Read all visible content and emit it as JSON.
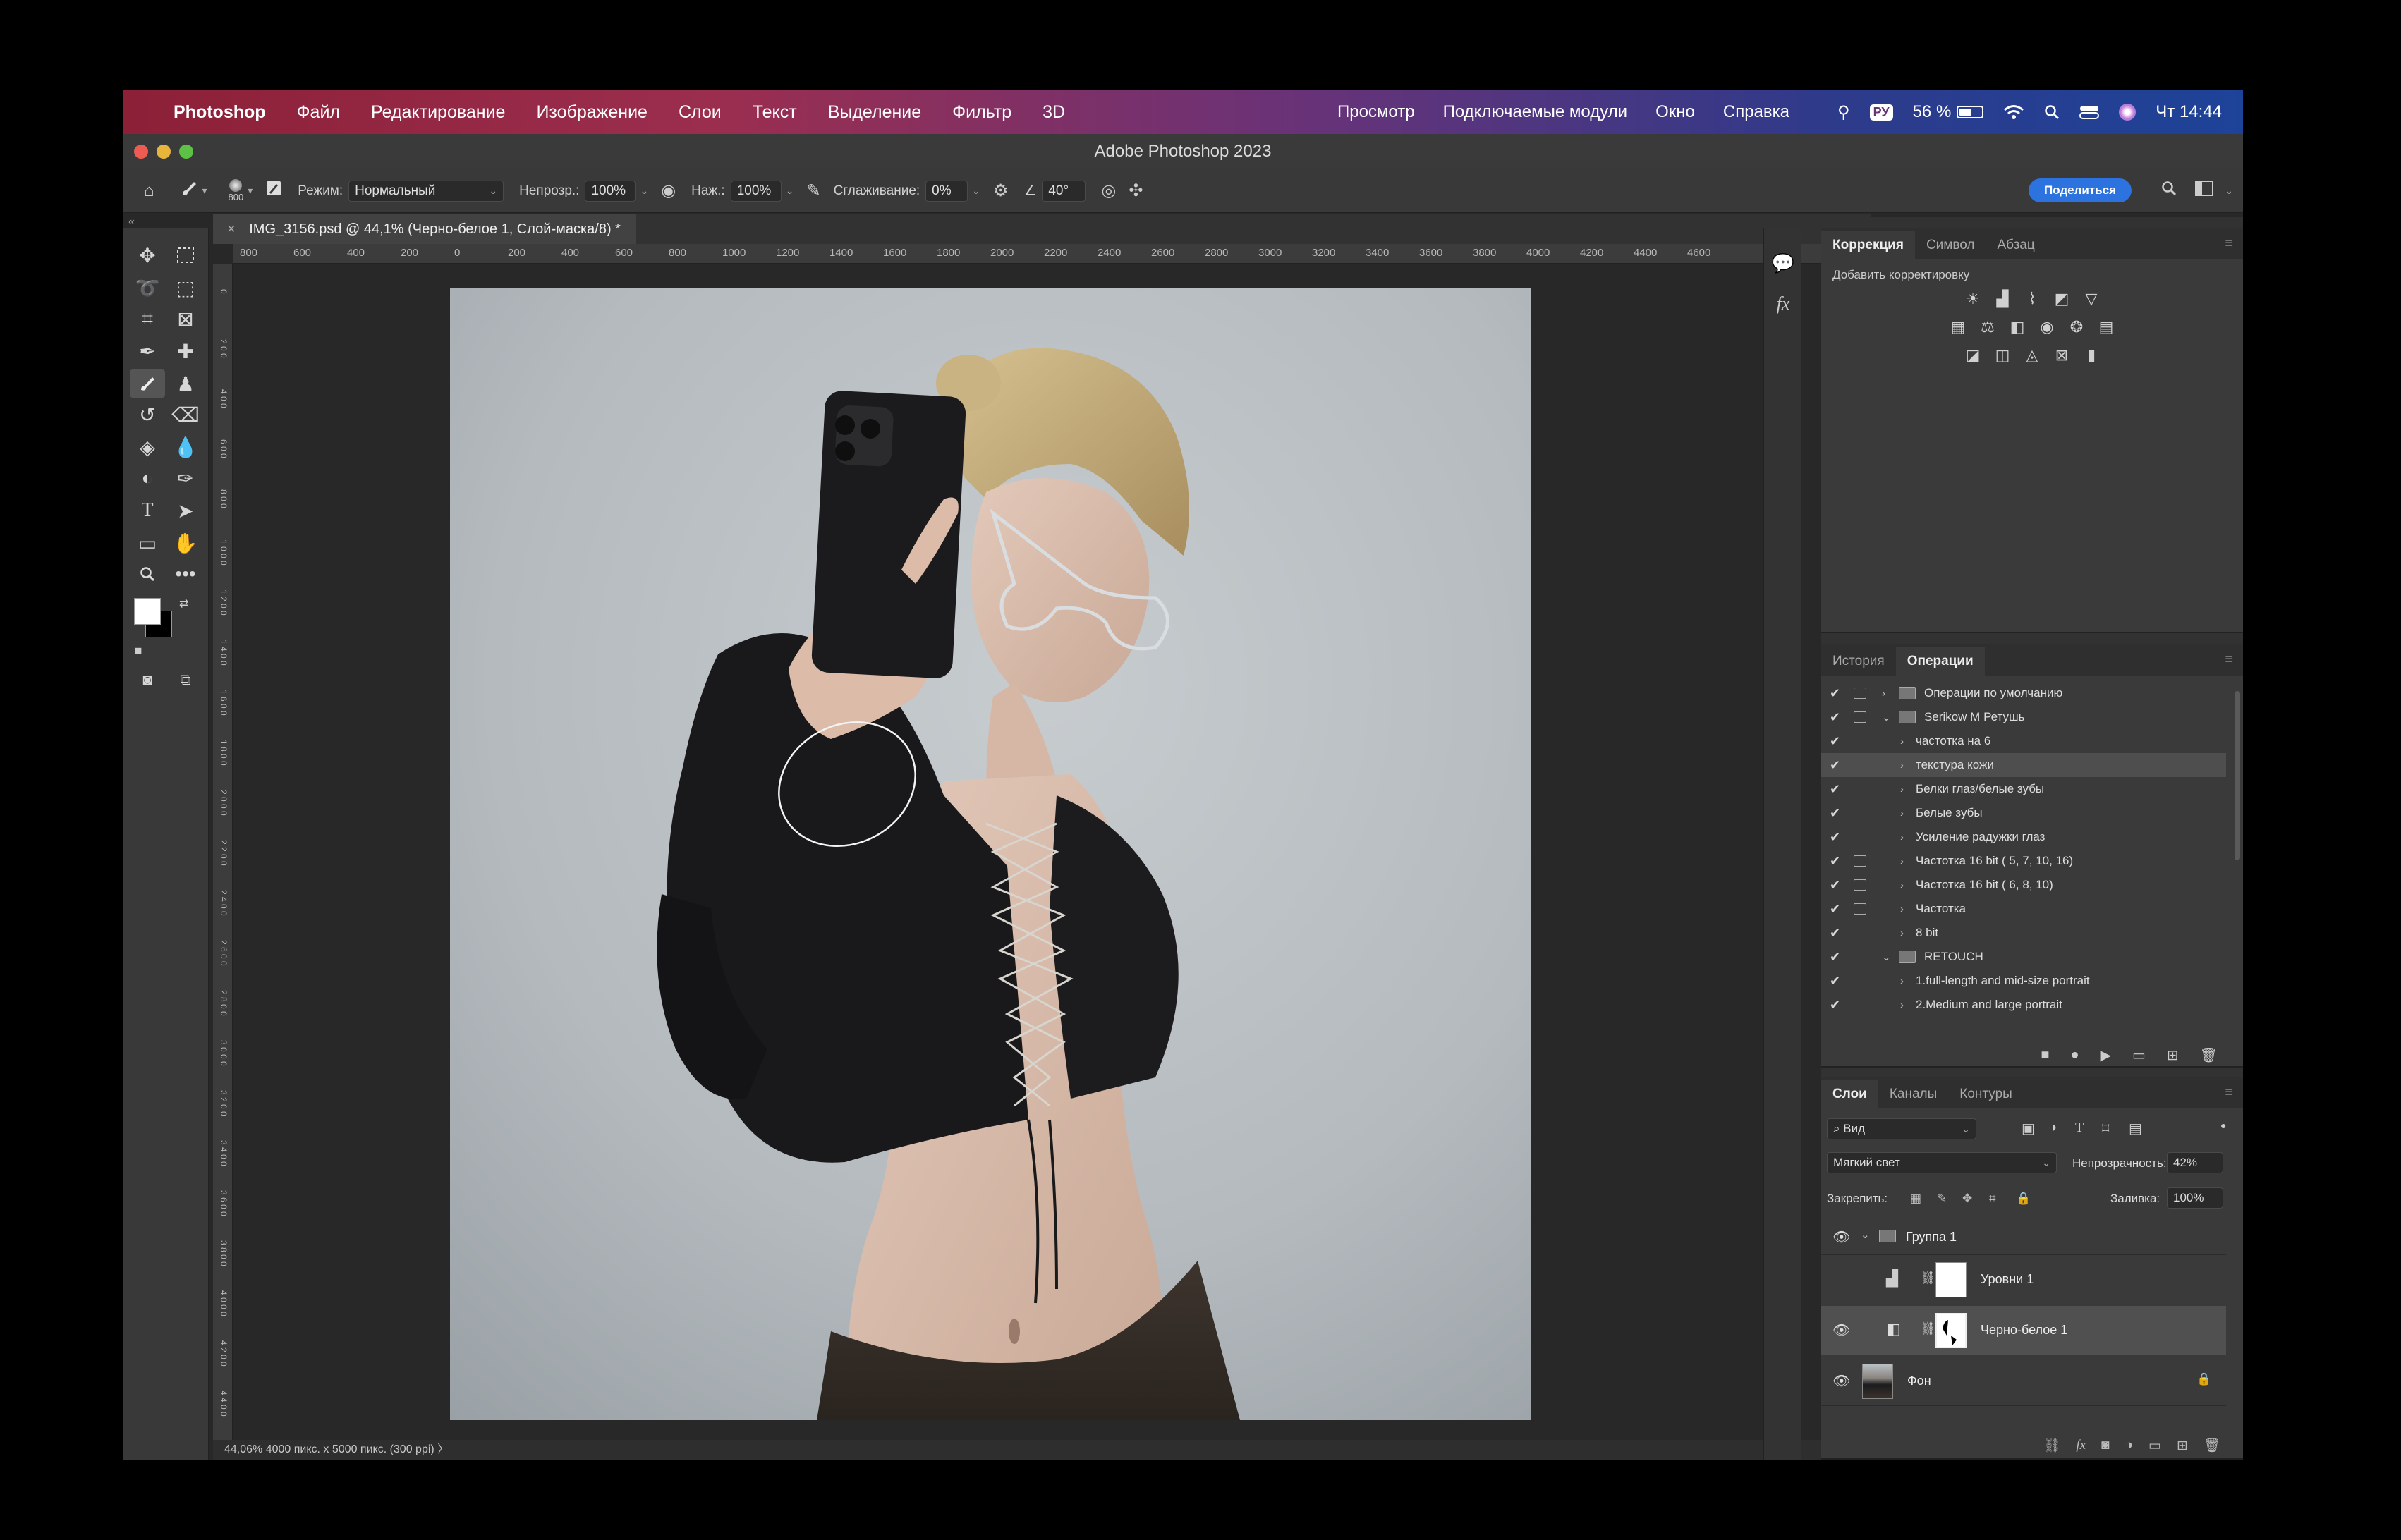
{
  "menubar": {
    "app_name": "Photoshop",
    "items": [
      "Файл",
      "Редактирование",
      "Изображение",
      "Слои",
      "Текст",
      "Выделение",
      "Фильтр",
      "3D"
    ],
    "right_items": [
      "Просмотр",
      "Подключаемые модули",
      "Окно",
      "Справка"
    ],
    "status": {
      "keyboard_layout": "РУ",
      "battery": "56 %",
      "battery_level": 0.56,
      "clock": "Чт 14:44"
    }
  },
  "window": {
    "title": "Adobe Photoshop 2023"
  },
  "options": {
    "brush_size": "800",
    "mode_label": "Режим:",
    "mode_value": "Нормальный",
    "opacity_label": "Непрозр.:",
    "opacity_value": "100%",
    "pressure_label": "Наж.:",
    "pressure_value": "100%",
    "smoothing_label": "Сглаживание:",
    "smoothing_value": "0%",
    "angle_value": "40°",
    "share_label": "Поделиться"
  },
  "document": {
    "tab_title": "IMG_3156.psd @ 44,1% (Черно-белое 1, Слой-маска/8) *",
    "status": "44,06%    4000 пикс. x 5000 пикс. (300 ppi)  〉",
    "ruler_h": [
      "800",
      "600",
      "400",
      "200",
      "0",
      "200",
      "400",
      "600",
      "800",
      "1000",
      "1200",
      "1400",
      "1600",
      "1800",
      "2000",
      "2200",
      "2400",
      "2600",
      "2800",
      "3000",
      "3200",
      "3400",
      "3600",
      "3800",
      "4000",
      "4200",
      "4400",
      "4600"
    ],
    "ruler_v": [
      "0",
      "2 0 0",
      "4 0 0",
      "6 0 0",
      "8 0 0",
      "1 0 0 0",
      "1 2 0 0",
      "1 4 0 0",
      "1 6 0 0",
      "1 8 0 0",
      "2 0 0 0",
      "2 2 0 0",
      "2 4 0 0",
      "2 6 0 0",
      "2 8 0 0",
      "3 0 0 0",
      "3 2 0 0",
      "3 4 0 0",
      "3 6 0 0",
      "3 8 0 0",
      "4 0 0 0",
      "4 2 0 0",
      "4 4 0 0",
      "4 6 0 0",
      "4 8 0 0"
    ]
  },
  "adjustments_panel": {
    "tabs": [
      "Коррекция",
      "Символ",
      "Абзац"
    ],
    "subtitle": "Добавить корректировку"
  },
  "actions_panel": {
    "tabs": [
      "История",
      "Операции"
    ],
    "rows": [
      {
        "label": "Операции по умолчанию",
        "type": "set",
        "expanded": false,
        "dialog": true
      },
      {
        "label": "Serikow M Ретушь",
        "type": "set",
        "expanded": true,
        "dialog": true
      },
      {
        "label": "частотка на 6",
        "type": "action",
        "dialog": false
      },
      {
        "label": "текстура кожи",
        "type": "action",
        "dialog": false,
        "selected": true
      },
      {
        "label": "Белки глаз/белые зубы",
        "type": "action",
        "dialog": false
      },
      {
        "label": "Белые зубы",
        "type": "action",
        "dialog": false
      },
      {
        "label": "Усиление радужки глаз",
        "type": "action",
        "dialog": false
      },
      {
        "label": "Частотка 16 bit  ( 5, 7, 10, 16)",
        "type": "action",
        "dialog": true
      },
      {
        "label": "Частотка 16 bit  ( 6, 8, 10)",
        "type": "action",
        "dialog": true
      },
      {
        "label": "Частотка",
        "type": "action",
        "dialog": true
      },
      {
        "label": "8 bit",
        "type": "action",
        "dialog": false
      },
      {
        "label": "RETOUCH",
        "type": "set",
        "expanded": true,
        "dialog": false
      },
      {
        "label": "1.full-length and mid-size portrait",
        "type": "action",
        "dialog": false
      },
      {
        "label": "2.Medium and large portrait",
        "type": "action",
        "dialog": false
      }
    ]
  },
  "layers_panel": {
    "tabs": [
      "Слои",
      "Каналы",
      "Контуры"
    ],
    "filter_label": "Вид",
    "blend_mode": "Мягкий свет",
    "opacity_label": "Непрозрачность:",
    "opacity_value": "42%",
    "lock_label": "Закрепить:",
    "fill_label": "Заливка:",
    "fill_value": "100%",
    "layers": [
      {
        "name": "Группа 1",
        "kind": "group",
        "visible": true
      },
      {
        "name": "Уровни 1",
        "kind": "levels",
        "visible": false
      },
      {
        "name": "Черно-белое 1",
        "kind": "bw",
        "visible": true,
        "selected": true
      },
      {
        "name": "Фон",
        "kind": "background",
        "visible": true,
        "locked": true
      }
    ]
  }
}
